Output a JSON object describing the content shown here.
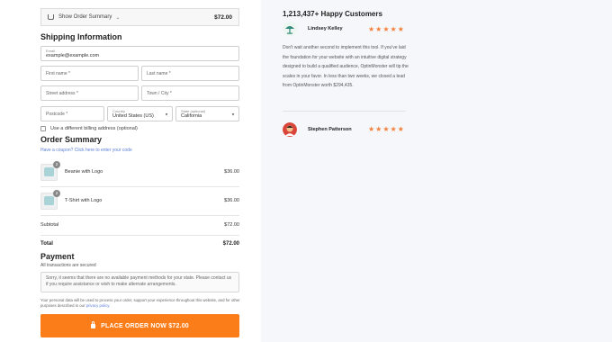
{
  "order_summary_bar": {
    "label": "Show Order Summary",
    "total": "$72.00"
  },
  "shipping": {
    "title": "Shipping Information",
    "email": {
      "label": "Email",
      "value": "example@example.com"
    },
    "first_name": {
      "placeholder": "First name *"
    },
    "last_name": {
      "placeholder": "Last name *"
    },
    "street": {
      "placeholder": "Street address *"
    },
    "town": {
      "placeholder": "Town / City *"
    },
    "postcode": {
      "placeholder": "Postcode *"
    },
    "country": {
      "label": "Country",
      "value": "United States (US)"
    },
    "state": {
      "label": "State (optional)",
      "value": "California"
    },
    "billing_checkbox": "Use a different billing address (optional)"
  },
  "order": {
    "title": "Order Summary",
    "coupon": "Have a coupon? Click here to enter your code",
    "items": [
      {
        "name": "Beanie with Logo",
        "qty": "2",
        "price": "$36.00"
      },
      {
        "name": "T-Shirt with Logo",
        "qty": "2",
        "price": "$36.00"
      }
    ],
    "subtotal_label": "Subtotal",
    "subtotal_value": "$72.00",
    "total_label": "Total",
    "total_value": "$72.00"
  },
  "payment": {
    "title": "Payment",
    "secured": "All transactions are secured",
    "notice": "Sorry, it seems that there are no available payment methods for your state. Please contact us if you require assistance or wish to make alternate arrangements.",
    "privacy_text": "Your personal data will be used to process your order, support your experience throughout this website, and for other purposes described in our",
    "privacy_link": "privacy policy.",
    "place_order": "PLACE ORDER NOW",
    "place_order_amount": "$72.00"
  },
  "testimonials": {
    "headline": "1,213,437+ Happy Customers",
    "reviews": [
      {
        "name": "Lindsey Kelley",
        "stars": 5,
        "text": "Don't wait another second to implement this tool. If you've laid the foundation for your website with an intuitive digital strategy designed to build a qualified audience, OptinMonster will tip the scales in your favor. In less than two weeks, we closed a lead from OptinMonster worth $294,435."
      },
      {
        "name": "Stephen Patterson",
        "stars": 5
      }
    ]
  },
  "colors": {
    "accent": "#fb7d1a",
    "star": "#f2803a",
    "link": "#5a7fd6",
    "right_bg": "#f5f7fb"
  }
}
